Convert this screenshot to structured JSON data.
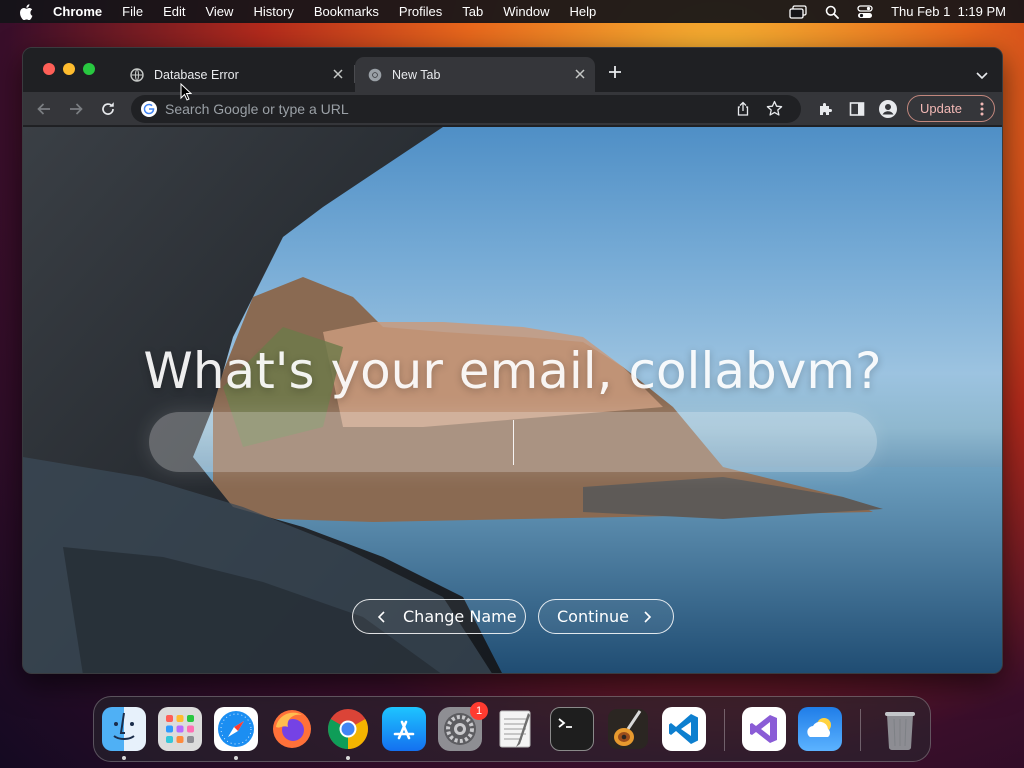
{
  "menubar": {
    "app_name": "Chrome",
    "items": [
      "File",
      "Edit",
      "View",
      "History",
      "Bookmarks",
      "Profiles",
      "Tab",
      "Window",
      "Help"
    ],
    "datetime": "Thu Feb 1  1:19 PM"
  },
  "browser": {
    "tabs": [
      {
        "title": "Database Error",
        "active": false
      },
      {
        "title": "New Tab",
        "active": true
      }
    ],
    "omnibox_placeholder": "Search Google or type a URL",
    "update_label": "Update"
  },
  "page": {
    "headline": "What's your email, collabvm?",
    "email_value": "",
    "change_name_label": "Change Name",
    "continue_label": "Continue"
  },
  "dock": {
    "apps": [
      "Finder",
      "Launchpad",
      "Safari",
      "Firefox",
      "Google Chrome",
      "App Store",
      "System Settings",
      "TextEdit",
      "Terminal",
      "GarageBand",
      "Visual Studio Code",
      "Visual Studio",
      "Weather",
      "Trash"
    ],
    "system_settings_badge": "1"
  },
  "colors": {
    "accent_update": "#f2b8b5",
    "badge": "#ff3b30"
  }
}
